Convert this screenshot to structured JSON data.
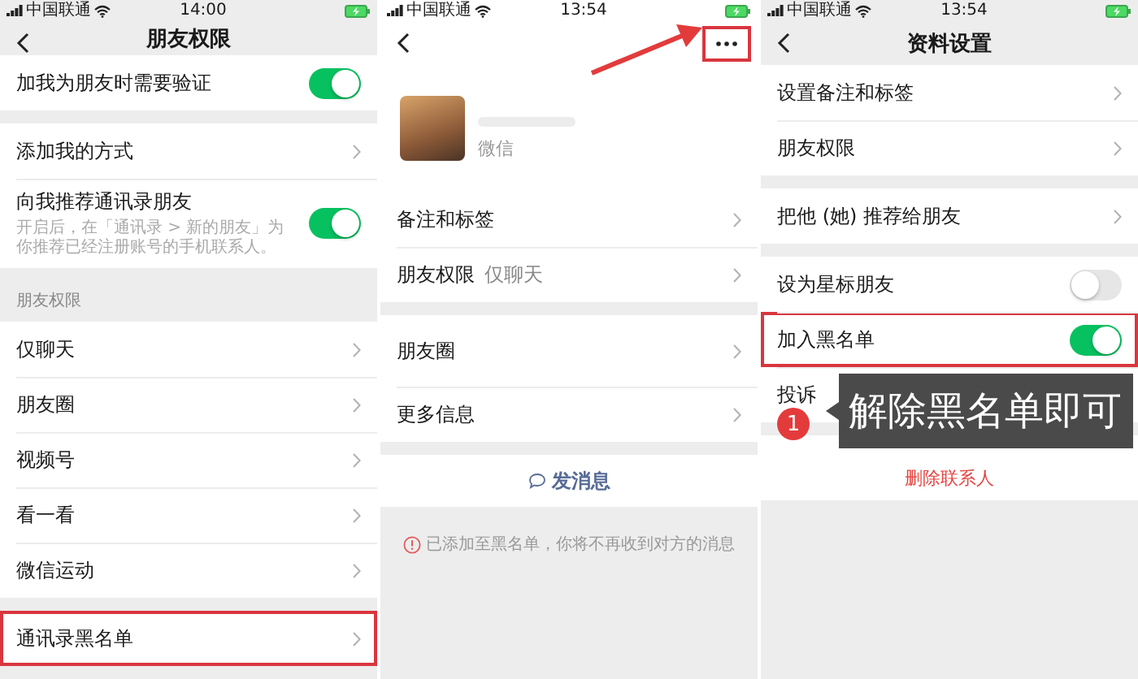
{
  "privacy_screen": {
    "status_bar": {
      "carrier": "中国联通",
      "time": "14:00"
    },
    "title": "朋友权限",
    "groups": [
      {
        "rows": [
          {
            "kind": "toggle",
            "label": "加我为朋友时需要验证",
            "on": true,
            "highlighted": false
          }
        ]
      },
      {
        "rows": [
          {
            "kind": "link",
            "label": "添加我的方式",
            "highlighted": false
          },
          {
            "kind": "toggle",
            "label": "向我推荐通讯录朋友",
            "description": "开启后，在「通讯录 > 新的朋友」为你推荐已经注册账号的手机联系人。",
            "on": true,
            "highlighted": false
          }
        ]
      },
      {
        "header": "朋友权限",
        "rows": [
          {
            "kind": "link",
            "label": "仅聊天",
            "highlighted": false
          },
          {
            "kind": "link",
            "label": "朋友圈",
            "highlighted": false
          },
          {
            "kind": "link",
            "label": "视频号",
            "highlighted": false
          },
          {
            "kind": "link",
            "label": "看一看",
            "highlighted": false
          },
          {
            "kind": "link",
            "label": "微信运动",
            "highlighted": false
          }
        ]
      },
      {
        "rows": [
          {
            "kind": "link",
            "label": "通讯录黑名单",
            "highlighted": true
          }
        ]
      }
    ]
  },
  "profile_screen": {
    "status_bar": {
      "carrier": "中国联通",
      "time": "13:54"
    },
    "more_button_highlighted": true,
    "contact": {
      "wechat_id": "微信"
    },
    "groups": [
      {
        "rows": [
          {
            "kind": "link",
            "label": "备注和标签",
            "highlighted": false
          },
          {
            "kind": "link",
            "label": "朋友权限",
            "value": "仅聊天",
            "highlighted": false
          }
        ]
      },
      {
        "rows": [
          {
            "kind": "moments",
            "label": "朋友圈",
            "highlighted": false
          },
          {
            "kind": "link",
            "label": "更多信息",
            "highlighted": false
          }
        ]
      }
    ],
    "send_button": "发消息",
    "notice": "已添加至黑名单，你将不再收到对方的消息"
  },
  "settings_screen": {
    "status_bar": {
      "carrier": "中国联通",
      "time": "13:54"
    },
    "title": "资料设置",
    "groups": [
      {
        "rows": [
          {
            "kind": "link",
            "label": "设置备注和标签",
            "highlighted": false
          },
          {
            "kind": "link",
            "label": "朋友权限",
            "highlighted": false
          }
        ]
      },
      {
        "rows": [
          {
            "kind": "link",
            "label": "把他 (她) 推荐给朋友",
            "highlighted": false
          }
        ]
      },
      {
        "rows": [
          {
            "kind": "toggle",
            "label": "设为星标朋友",
            "on": false,
            "highlighted": false
          },
          {
            "kind": "toggle",
            "label": "加入黑名单",
            "on": true,
            "highlighted": true
          },
          {
            "kind": "link",
            "label": "投诉",
            "highlighted": false
          }
        ]
      },
      {
        "rows": [
          {
            "kind": "danger",
            "label": "删除联系人",
            "highlighted": false
          }
        ]
      }
    ]
  },
  "callout": {
    "number": "1",
    "text": "解除黑名单即可"
  }
}
